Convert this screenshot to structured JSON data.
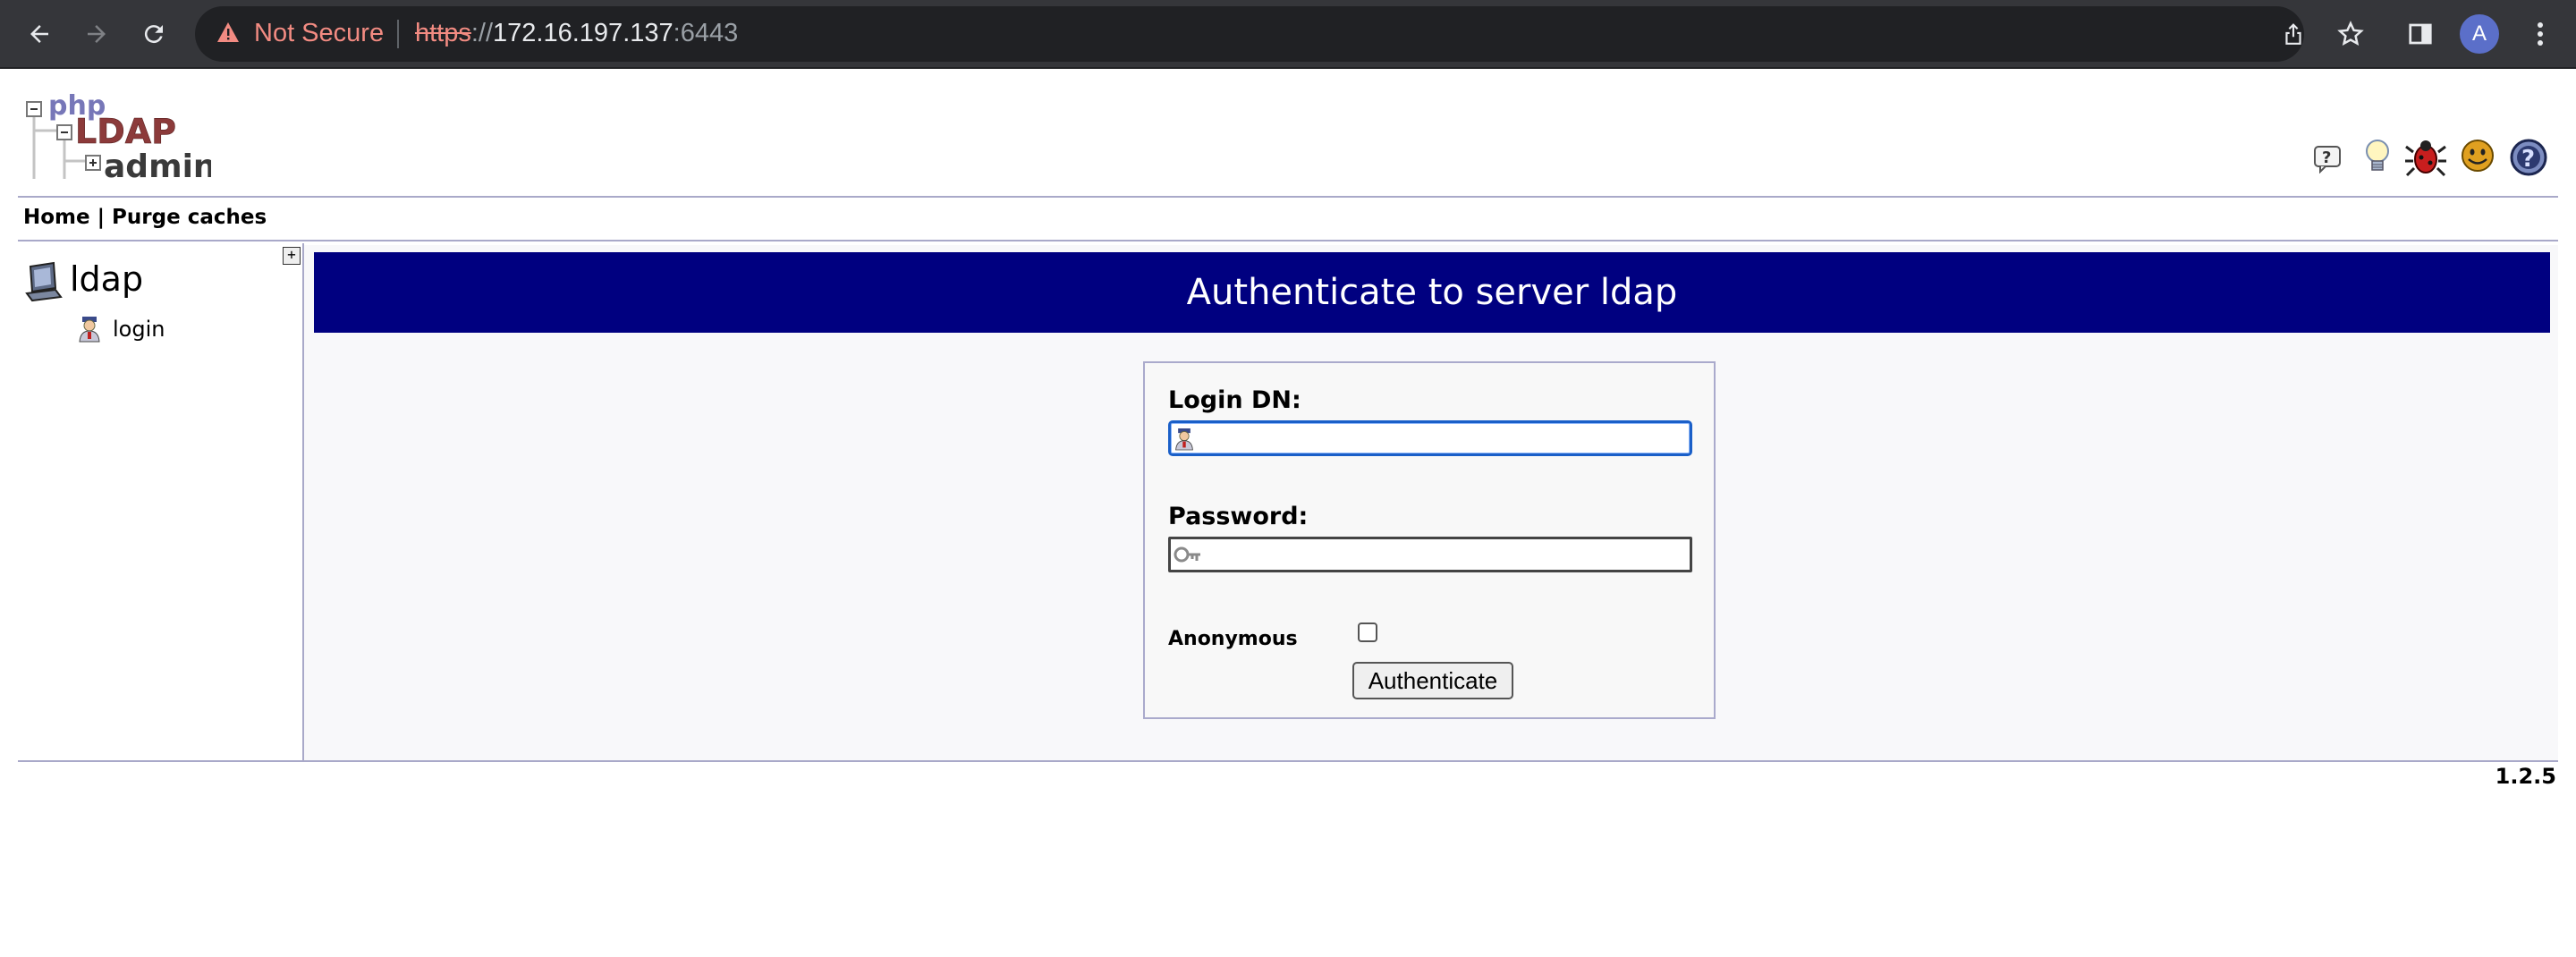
{
  "browser": {
    "security_label": "Not Secure",
    "url_scheme": "https",
    "url_sep": "://",
    "url_host": "172.16.197.137",
    "url_port": ":6443",
    "profile_initial": "A",
    "icons": [
      "back-arrow-icon",
      "forward-arrow-icon",
      "reload-icon",
      "warning-icon",
      "share-icon",
      "star-icon",
      "side-panel-icon",
      "more-vert-icon"
    ]
  },
  "logo": {
    "part1": "php",
    "part2": "LDAP",
    "part3": "admin"
  },
  "header_icons": [
    "help-icon",
    "lightbulb-icon",
    "bug-icon",
    "smiley-icon",
    "question-icon"
  ],
  "menu": {
    "home": "Home",
    "separator": " | ",
    "purge": "Purge caches"
  },
  "tree": {
    "expand_symbol": "+",
    "server": "ldap",
    "login": "login"
  },
  "main": {
    "title": "Authenticate to server ldap",
    "login_dn_label": "Login DN:",
    "login_dn_value": "",
    "password_label": "Password:",
    "password_value": "",
    "anonymous_label": "Anonymous",
    "anonymous_checked": false,
    "authenticate_label": "Authenticate"
  },
  "footer": {
    "version": "1.2.5"
  },
  "colors": {
    "title_bar": "#000080",
    "rule": "#a9a9c9",
    "focus": "#1a5fc8"
  }
}
